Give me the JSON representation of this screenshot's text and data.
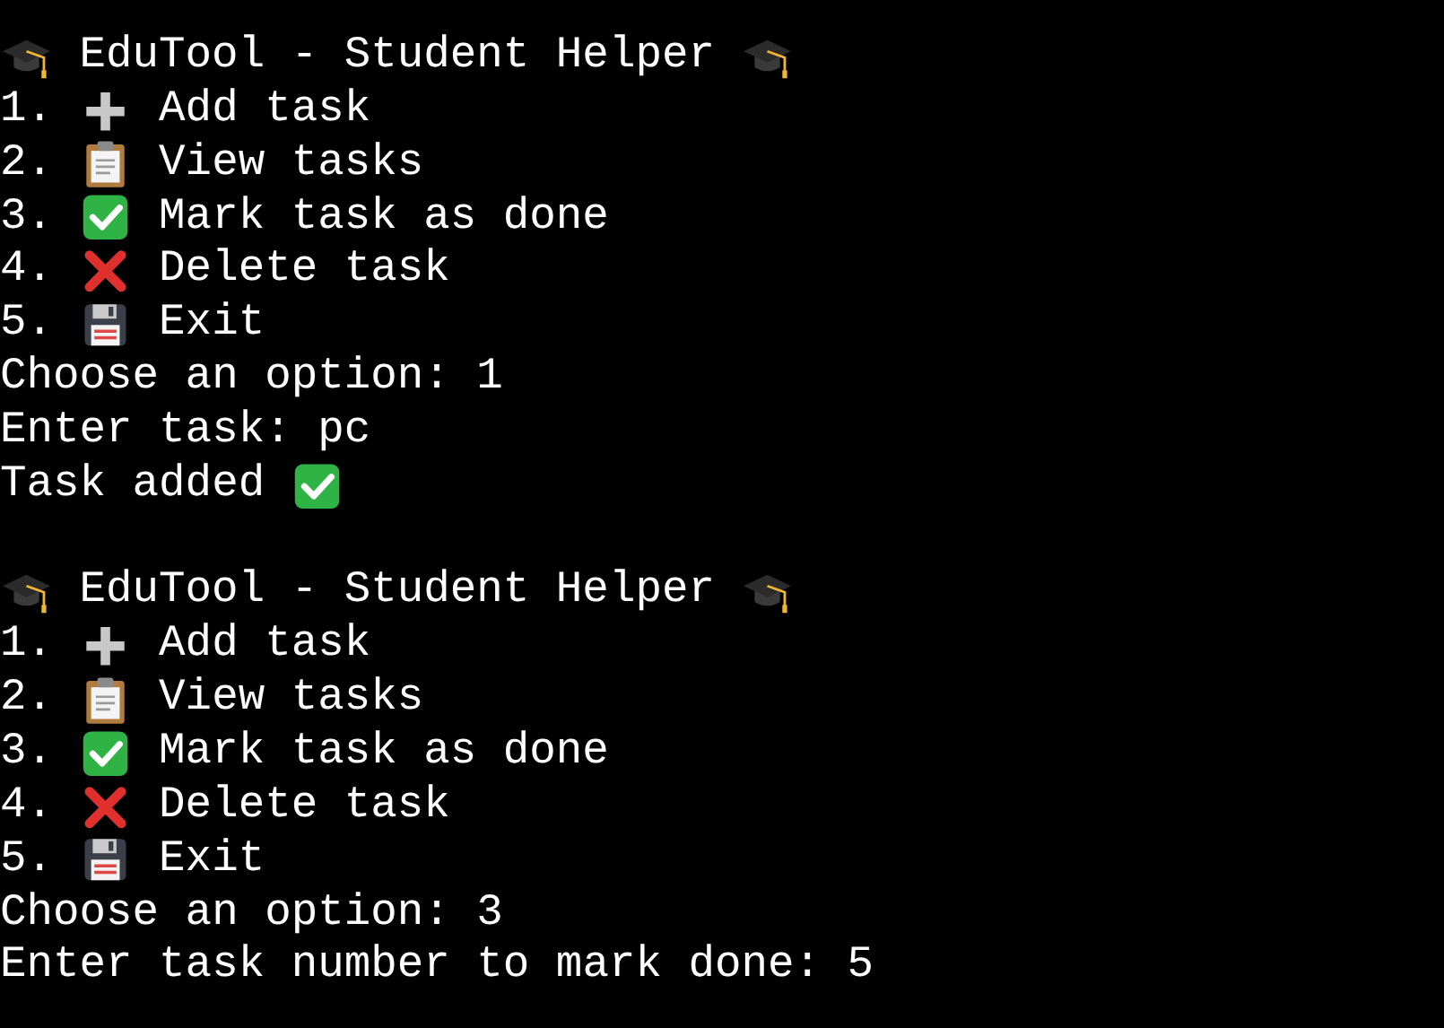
{
  "blocks": [
    {
      "title": "EduTool - Student Helper",
      "menu": [
        {
          "number": "1.",
          "label": "Add task"
        },
        {
          "number": "2.",
          "label": "View tasks"
        },
        {
          "number": "3.",
          "label": "Mark task as done"
        },
        {
          "number": "4.",
          "label": "Delete task"
        },
        {
          "number": "5.",
          "label": "Exit"
        }
      ],
      "output": [
        {
          "kind": "prompt",
          "text": "Choose an option: 1"
        },
        {
          "kind": "prompt",
          "text": "Enter task: pc"
        },
        {
          "kind": "success",
          "text": "Task added"
        }
      ]
    },
    {
      "title": "EduTool - Student Helper",
      "menu": [
        {
          "number": "1.",
          "label": "Add task"
        },
        {
          "number": "2.",
          "label": "View tasks"
        },
        {
          "number": "3.",
          "label": "Mark task as done"
        },
        {
          "number": "4.",
          "label": "Delete task"
        },
        {
          "number": "5.",
          "label": "Exit"
        }
      ],
      "output": [
        {
          "kind": "prompt",
          "text": "Choose an option: 3"
        },
        {
          "kind": "prompt",
          "text": "Enter task number to mark done: 5"
        }
      ]
    }
  ]
}
